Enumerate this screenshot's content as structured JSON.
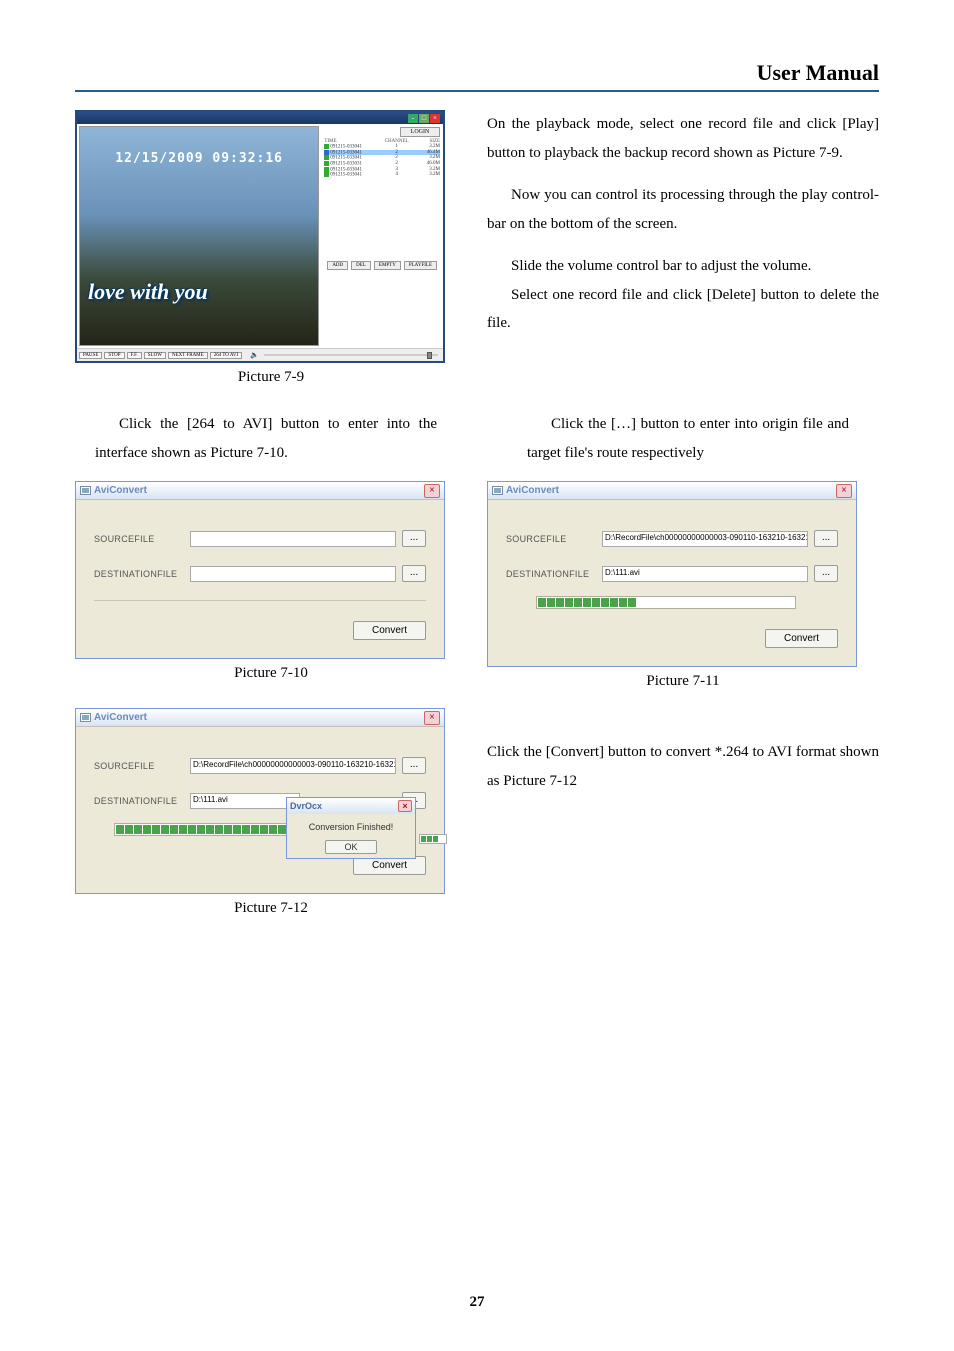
{
  "header": {
    "title": "User Manual"
  },
  "page_number": "27",
  "playback": {
    "timestamp": "12/15/2009 09:32:16",
    "watermark": "love with you",
    "login_btn": "LOGIN",
    "col_time": "TIME",
    "col_ch": "CHANNEL",
    "col_size": "SIZE",
    "rows": [
      {
        "name": "091215-033041",
        "ch": "1",
        "size": "3.2M"
      },
      {
        "name": "091215-033041",
        "ch": "2",
        "size": "46.4M"
      },
      {
        "name": "091215-033041",
        "ch": "2",
        "size": "3.2M"
      },
      {
        "name": "091215-033031",
        "ch": "2",
        "size": "46.0M"
      },
      {
        "name": "091215-033041",
        "ch": "3",
        "size": "3.2M"
      },
      {
        "name": "091215-033041",
        "ch": "4",
        "size": "3.2M"
      }
    ],
    "add_btn": "ADD",
    "del_btn": "DEL",
    "empty_btn": "EMPTY",
    "playfile_btn": "PLAYFILE",
    "ctrl_pause": "PAUSE",
    "ctrl_stop": "STOP",
    "ctrl_ff": "F.F.",
    "ctrl_slow": "SLOW",
    "ctrl_next": "NEXT FRAME",
    "ctrl_264": "264 TO AVI"
  },
  "captions": {
    "p79": "Picture 7-9",
    "p710": "Picture 7-10",
    "p711": "Picture 7-11",
    "p712": "Picture 7-12"
  },
  "text": {
    "right_p1": "On the playback mode, select one record file and click [Play] button to playback the backup record shown as Picture 7-9.",
    "right_p2": "Now you can control its processing through the play control-bar on the bottom of the screen.",
    "right_p3": "Slide the volume control bar to adjust the volume.",
    "right_p4": "Select one record file and click [Delete] button to delete the file.",
    "left_p5": "Click the [264 to AVI] button to enter into the interface shown as Picture 7-10.",
    "right_p5": "Click the […] button to enter into origin file and target file's route respectively",
    "right_p6": "Click the [Convert] button to convert *.264 to AVI format shown as Picture 7-12"
  },
  "avi": {
    "title": "AviConvert",
    "source_label": "SOURCEFILE",
    "dest_label": "DESTINATIONFILE",
    "browse": "...",
    "convert": "Convert",
    "source_value_filled": "D:\\RecordFile\\ch00000000000003-090110-163210-16321",
    "dest_value_filled": "D:\\111.avi"
  },
  "dvrocx": {
    "title": "DvrOcx",
    "msg": "Conversion Finished!",
    "ok": "OK"
  }
}
